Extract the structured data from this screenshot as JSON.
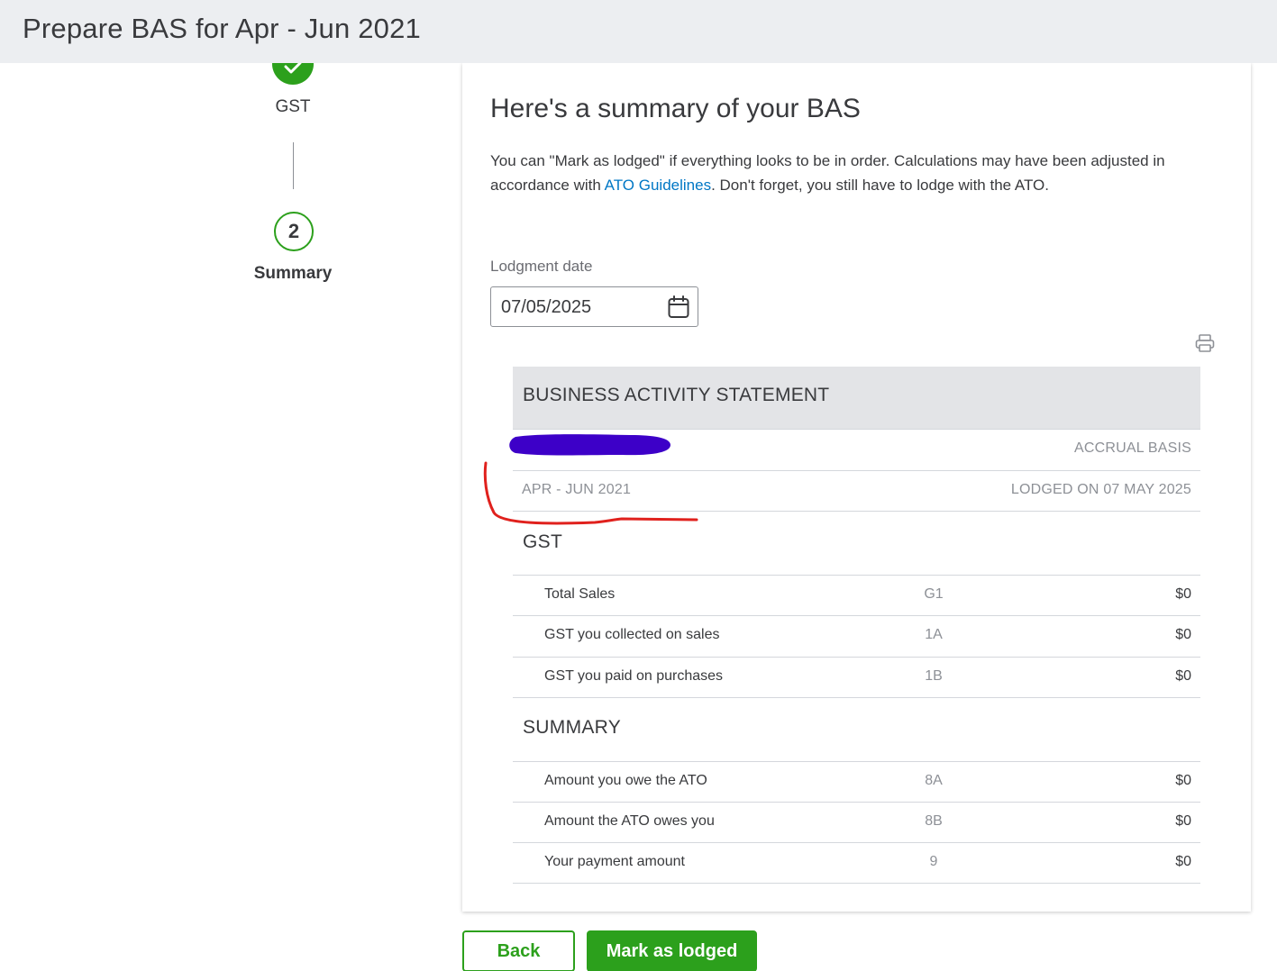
{
  "page": {
    "title": "Prepare BAS for Apr - Jun 2021"
  },
  "stepper": {
    "step1_label": "GST",
    "step2_number": "2",
    "step2_label": "Summary",
    "accent_color": "#2ca01c"
  },
  "summary": {
    "heading": "Here's a summary of your BAS",
    "intro_before_link": "You can \"Mark as lodged\" if everything looks to be in order. Calculations may have been adjusted in accordance with ",
    "intro_link": "ATO Guidelines",
    "intro_after_link": ". Don't forget, you still have to lodge with the ATO.",
    "link_color": "#0077c5"
  },
  "lodgment": {
    "label": "Lodgment date",
    "value": "07/05/2025",
    "icon": "calendar-icon"
  },
  "statement": {
    "print_icon": "print-icon",
    "title": "BUSINESS ACTIVITY STATEMENT",
    "basis": "ACCRUAL BASIS",
    "period": "APR - JUN 2021",
    "lodged_on": "LODGED ON 07 MAY 2025",
    "gst_section": "GST",
    "gst_rows": [
      {
        "label": "Total Sales",
        "code": "G1",
        "amount": "$0"
      },
      {
        "label": "GST you collected on sales",
        "code": "1A",
        "amount": "$0"
      },
      {
        "label": "GST you paid on purchases",
        "code": "1B",
        "amount": "$0"
      }
    ],
    "summary_section": "SUMMARY",
    "summary_rows": [
      {
        "label": "Amount you owe the ATO",
        "code": "8A",
        "amount": "$0"
      },
      {
        "label": "Amount the ATO owes you",
        "code": "8B",
        "amount": "$0"
      },
      {
        "label": "Your payment amount",
        "code": "9",
        "amount": "$0"
      }
    ]
  },
  "annotations": {
    "redaction_color": "#3d00c8",
    "underline_color": "#e0211d"
  },
  "buttons": {
    "back": "Back",
    "mark_lodged": "Mark as lodged"
  }
}
